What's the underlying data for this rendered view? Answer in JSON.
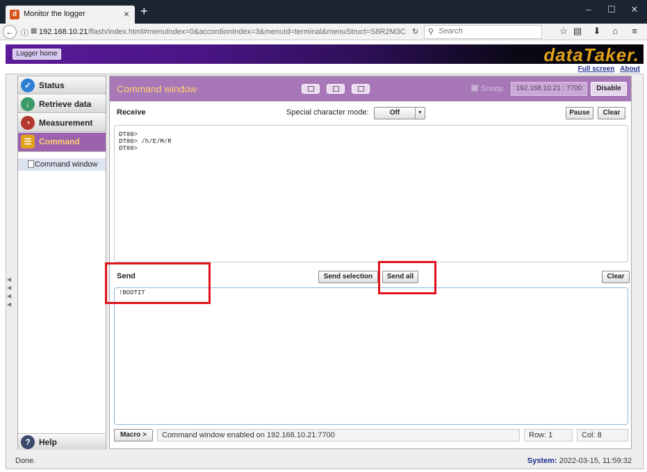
{
  "browser": {
    "tab_title": "Monitor the logger",
    "url_host": "192.168.10.21",
    "url_path": "/flash/index.html#menuIndex=0&accordionIndex=3&menuId=terminal&menuStruct=S8R2M3C",
    "search_placeholder": "Search"
  },
  "page": {
    "logger_home": "Logger home",
    "brand": "dataTaker.",
    "links": {
      "full_screen": "Full screen",
      "about": "About"
    }
  },
  "sidebar": {
    "items": [
      {
        "label": "Status",
        "icon": "check-icon",
        "color": "#2f7fd6"
      },
      {
        "label": "Retrieve data",
        "icon": "download-icon",
        "color": "#3a9a6a"
      },
      {
        "label": "Measurement",
        "icon": "gauge-icon",
        "color": "#b3372f"
      },
      {
        "label": "Command",
        "icon": "command-icon",
        "color": "#e0a11b"
      }
    ],
    "sub_item": "Command window",
    "help": "Help"
  },
  "command_window": {
    "title": "Command window",
    "snoop": "Snoop",
    "address": "192.168.10.21 : 7700",
    "disable": "Disable",
    "receive": {
      "label": "Receive",
      "special_char_label": "Special character mode:",
      "special_char_value": "Off",
      "pause": "Pause",
      "clear": "Clear",
      "lines": [
        "DT80>",
        "DT80> /h/E/M/R",
        "DT80>"
      ]
    },
    "send": {
      "label": "Send",
      "send_selection": "Send selection",
      "send_all": "Send all",
      "clear": "Clear",
      "text": "!BOOTIT"
    },
    "status": {
      "macro": "Macro >",
      "message": "Command window enabled on 192.168.10.21:7700",
      "row": "Row:  1",
      "col": "Col:  8"
    }
  },
  "footer": {
    "done": "Done.",
    "system_label": "System:",
    "system_time": "2022-03-15, 11:59:32"
  },
  "colors": {
    "header_purple": "#a777b8",
    "accent_gold": "#e0a11b",
    "highlight_red": "#e0101a"
  }
}
